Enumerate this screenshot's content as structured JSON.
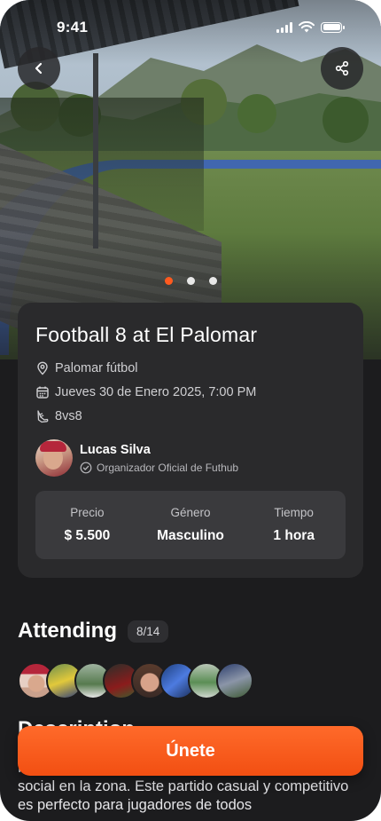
{
  "status_bar": {
    "time": "9:41"
  },
  "carousel": {
    "count": 3,
    "active_index": 0
  },
  "event": {
    "title": "Football 8 at El Palomar",
    "location": "Palomar fútbol",
    "datetime": "Jueves 30 de Enero 2025, 7:00 PM",
    "format": "8vs8",
    "organizer": {
      "name": "Lucas Silva",
      "role": "Organizador Oficial de Futhub"
    },
    "stats": [
      {
        "label": "Precio",
        "value": "$ 5.500"
      },
      {
        "label": "Género",
        "value": "Masculino"
      },
      {
        "label": "Tiempo",
        "value": "1 hora"
      }
    ]
  },
  "attending": {
    "heading": "Attending",
    "count": "8/14"
  },
  "description": {
    "heading": "Description",
    "text": "Palomar. Únete a nosotros si buscas jugar a fútbol 6 social en la zona. Este partido casual y competitivo es perfecto para jugadores de todos"
  },
  "join_button": {
    "label": "Únete"
  },
  "colors": {
    "accent": "#ff5a1f",
    "background": "#1c1c1e",
    "card": "#2a2a2c"
  },
  "icons": [
    "chevron-left-icon",
    "share-icon",
    "location-pin-icon",
    "calendar-icon",
    "shoe-icon",
    "verified-check-icon"
  ]
}
